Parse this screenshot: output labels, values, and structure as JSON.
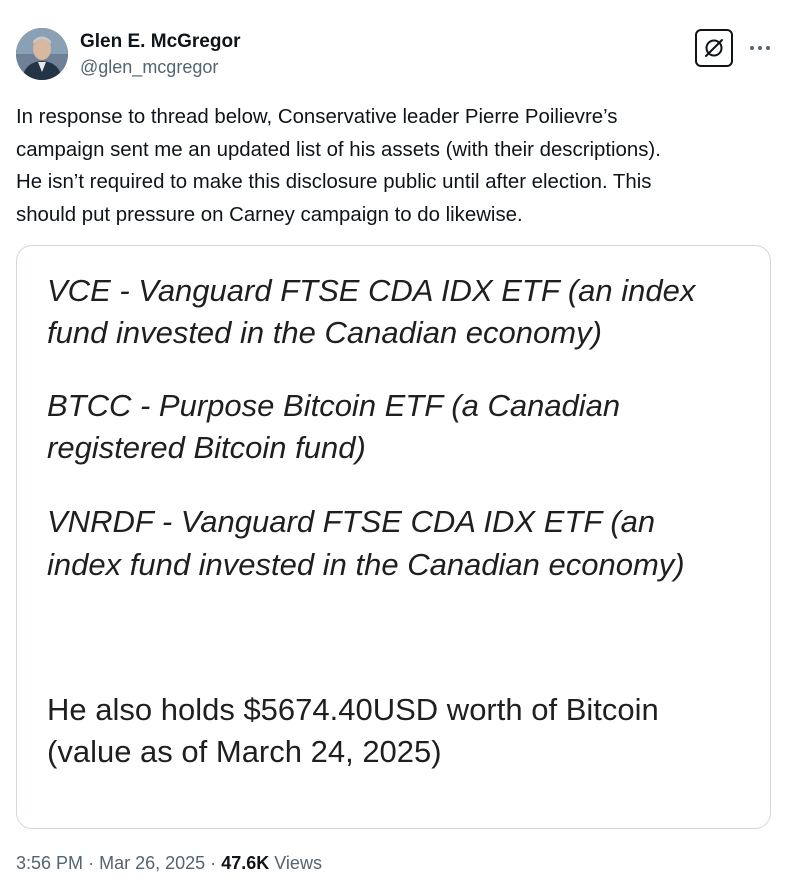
{
  "author": {
    "display_name": "Glen E. McGregor",
    "handle": "@glen_mcgregor"
  },
  "tweet": {
    "text_lines": [
      "In response to thread below, Conservative leader Pierre Poilievre’s",
      "campaign sent me an updated list of his assets (with their descriptions).",
      "He isn’t required to make this disclosure public until after election. This",
      "should put pressure on Carney campaign to do likewise."
    ]
  },
  "media": {
    "lines": [
      "VCE - Vanguard FTSE CDA IDX ETF (an index",
      "fund invested in the Canadian economy)",
      "BTCC - Purpose Bitcoin ETF (a Canadian",
      "registered Bitcoin fund)",
      "VNRDF - Vanguard FTSE CDA IDX ETF (an",
      "index fund invested in the Canadian economy)",
      "He also holds $5674.40USD worth of Bitcoin",
      "(value as of March 24, 2025)"
    ]
  },
  "footer": {
    "time": "3:56 PM",
    "separator": "·",
    "date": "Mar 26, 2025",
    "views_count": "47.6K",
    "views_label": "Views"
  },
  "icons": {
    "grok": "grok-icon",
    "more": "more-horizontal-icon"
  },
  "colors": {
    "text_primary": "#0f1419",
    "text_secondary": "#536471",
    "border": "#cfd9de"
  }
}
